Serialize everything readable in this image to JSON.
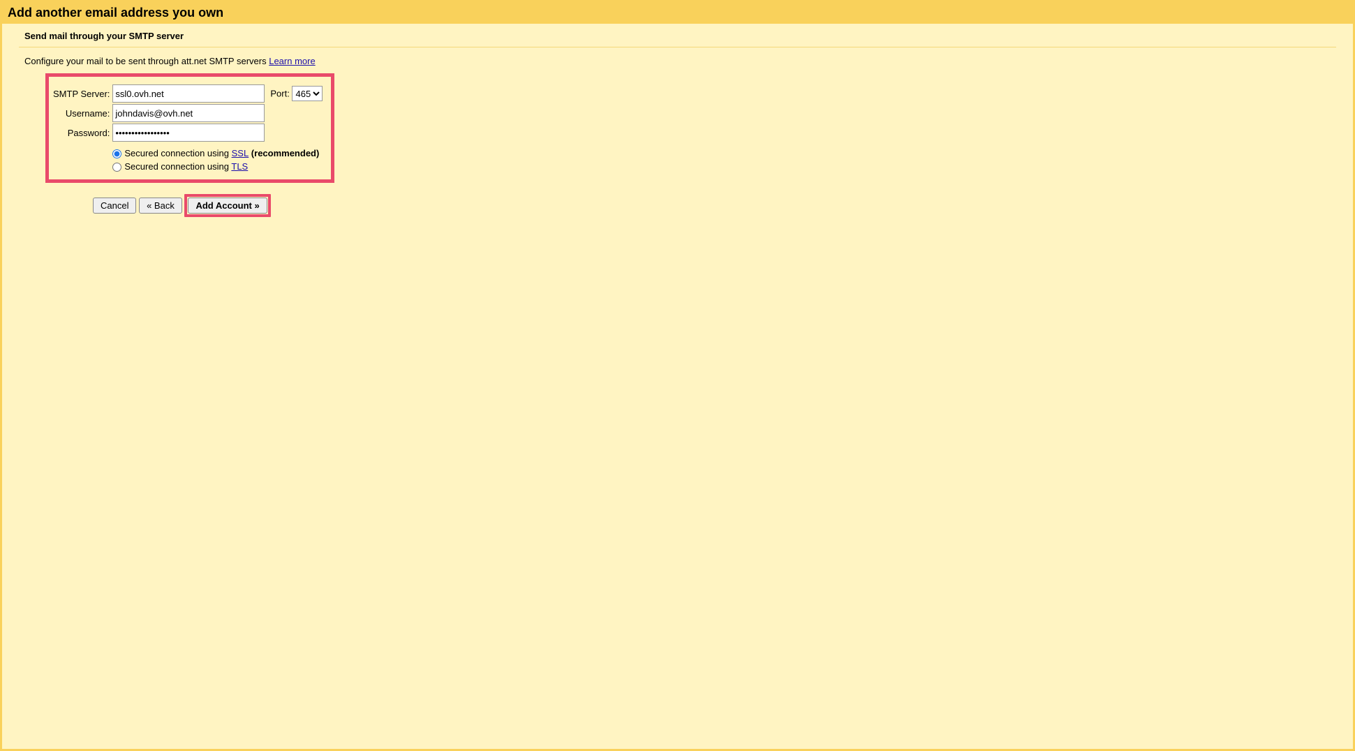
{
  "header": {
    "title": "Add another email address you own",
    "subtitle": "Send mail through your SMTP server"
  },
  "instruction": {
    "text": "Configure your mail to be sent through att.net SMTP servers ",
    "learn_more_label": "Learn more"
  },
  "form": {
    "smtp_label": "SMTP Server:",
    "smtp_value": "ssl0.ovh.net",
    "port_label": "Port:",
    "port_value": "465",
    "username_label": "Username:",
    "username_value": "johndavis@ovh.net",
    "password_label": "Password:",
    "password_value": "•••••••••••••••••",
    "ssl_prefix": "Secured connection using ",
    "ssl_link": "SSL",
    "ssl_suffix": " (recommended)",
    "tls_prefix": "Secured connection using ",
    "tls_link": "TLS"
  },
  "buttons": {
    "cancel": "Cancel",
    "back": "« Back",
    "add_account": "Add Account »"
  }
}
